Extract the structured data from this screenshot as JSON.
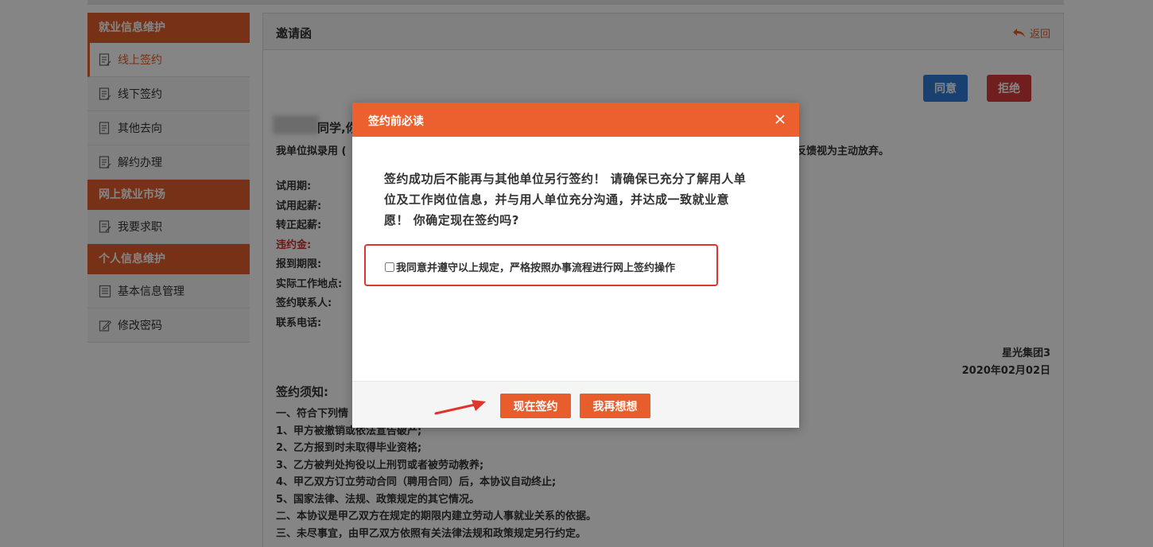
{
  "sidebar": {
    "sections": [
      {
        "title": "就业信息维护",
        "items": [
          {
            "label": "线上签约",
            "active": true
          },
          {
            "label": "线下签约"
          },
          {
            "label": "其他去向"
          },
          {
            "label": "解约办理"
          }
        ]
      },
      {
        "title": "网上就业市场",
        "items": [
          {
            "label": "我要求职"
          }
        ]
      },
      {
        "title": "个人信息维护",
        "items": [
          {
            "label": "基本信息管理"
          },
          {
            "label": "修改密码"
          }
        ]
      }
    ]
  },
  "main": {
    "title": "邀请函",
    "back_label": "返回",
    "agree_label": "同意",
    "reject_label": "拒绝",
    "greeting": "同学,你",
    "intro_left": "我单位拟录用 (",
    "intro_right": "反馈视为主动放弃。",
    "fields": [
      "试用期:",
      "试用起薪:",
      "转正起薪:",
      "违约金:",
      "报到期限:",
      "实际工作地点:",
      "签约联系人:",
      "联系电话:"
    ],
    "company": "星光集团3",
    "date": "2020年02月02日",
    "notice_title": "签约须知:",
    "notice_lines": [
      "一、符合下列情",
      "1、甲方被撤销或依法宣告破产;",
      "2、乙方报到时未取得毕业资格;",
      "3、乙方被判处拘役以上刑罚或者被劳动教养;",
      "4、甲乙双方订立劳动合同（聘用合同）后，本协议自动终止;",
      "5、国家法律、法规、政策规定的其它情况。",
      "二、本协议是甲乙双方在规定的期限内建立劳动人事就业关系的依据。",
      "三、未尽事宜，由甲乙双方依照有关法律法规和政策规定另行约定。"
    ]
  },
  "modal": {
    "title": "签约前必读",
    "text_lines": [
      "签约成功后不能再与其他单位另行签约！ 请确保已充分了解用人单",
      "位及工作岗位信息，并与用人单位充分沟通，并达成一致就业意",
      "愿！ 你确定现在签约吗?"
    ],
    "checkbox_label": "我同意并遵守以上规定，严格按照办事流程进行网上签约操作",
    "checkbox_checked": false,
    "sign_label": "现在签约",
    "think_label": "我再想想"
  },
  "colors": {
    "accent": "#e35f2b",
    "agree": "#2f7bd8",
    "reject": "#d93a3a",
    "highlight": "#e0342f"
  }
}
